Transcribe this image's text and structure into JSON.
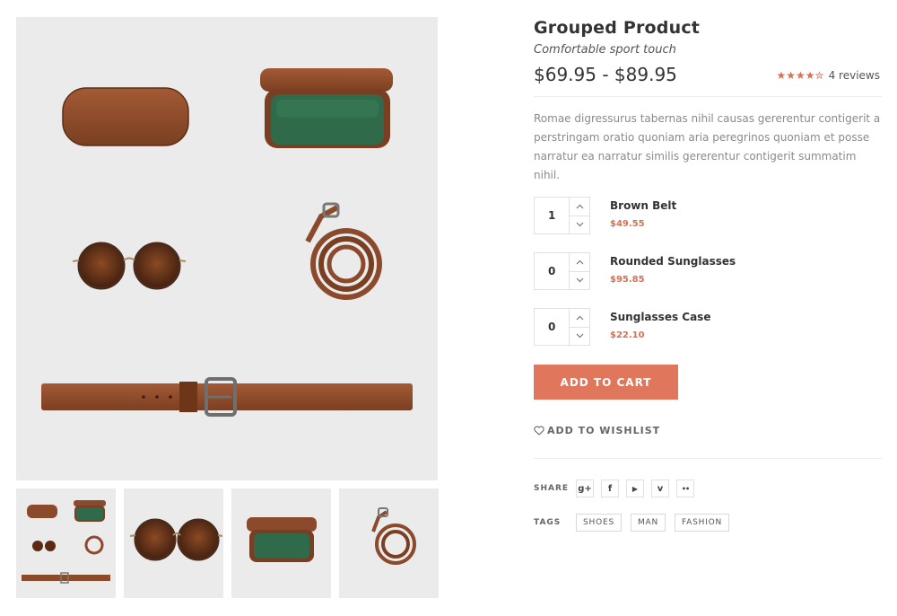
{
  "product": {
    "title": "Grouped Product",
    "subtitle": "Comfortable sport touch",
    "price": "$69.95 - $89.95",
    "rating": 4.5,
    "stars": "★★★★✮",
    "reviews": "4 reviews",
    "description": "Romae digressurus tabernas nihil causas gererentur contigerit a perstringam oratio quoniam aria peregrinos quoniam et posse narratur ea narratur similis gererentur contigerit summatim nihil."
  },
  "grouped_items": [
    {
      "qty": "1",
      "name": "Brown Belt",
      "price": "$49.55"
    },
    {
      "qty": "0",
      "name": "Rounded Sunglasses",
      "price": "$95.85"
    },
    {
      "qty": "0",
      "name": "Sunglasses Case",
      "price": "$22.10"
    }
  ],
  "actions": {
    "add_to_cart": "ADD TO CART",
    "wishlist": "ADD TO WISHLIST"
  },
  "meta": {
    "share_label": "SHARE",
    "social": [
      {
        "icon": "google-plus-icon",
        "glyph": "g+"
      },
      {
        "icon": "facebook-icon",
        "glyph": "f"
      },
      {
        "icon": "youtube-icon",
        "glyph": "▶"
      },
      {
        "icon": "vimeo-icon",
        "glyph": "v"
      },
      {
        "icon": "flickr-icon",
        "glyph": "••"
      }
    ],
    "tags_label": "TAGS",
    "tags": [
      "SHOES",
      "MAN",
      "FASHION"
    ]
  },
  "colors": {
    "accent": "#e0775c",
    "price_accent": "#d96f53",
    "image_bg": "#ebebeb",
    "leather": "#8b4a2b",
    "case_interior": "#2f6a4a"
  }
}
